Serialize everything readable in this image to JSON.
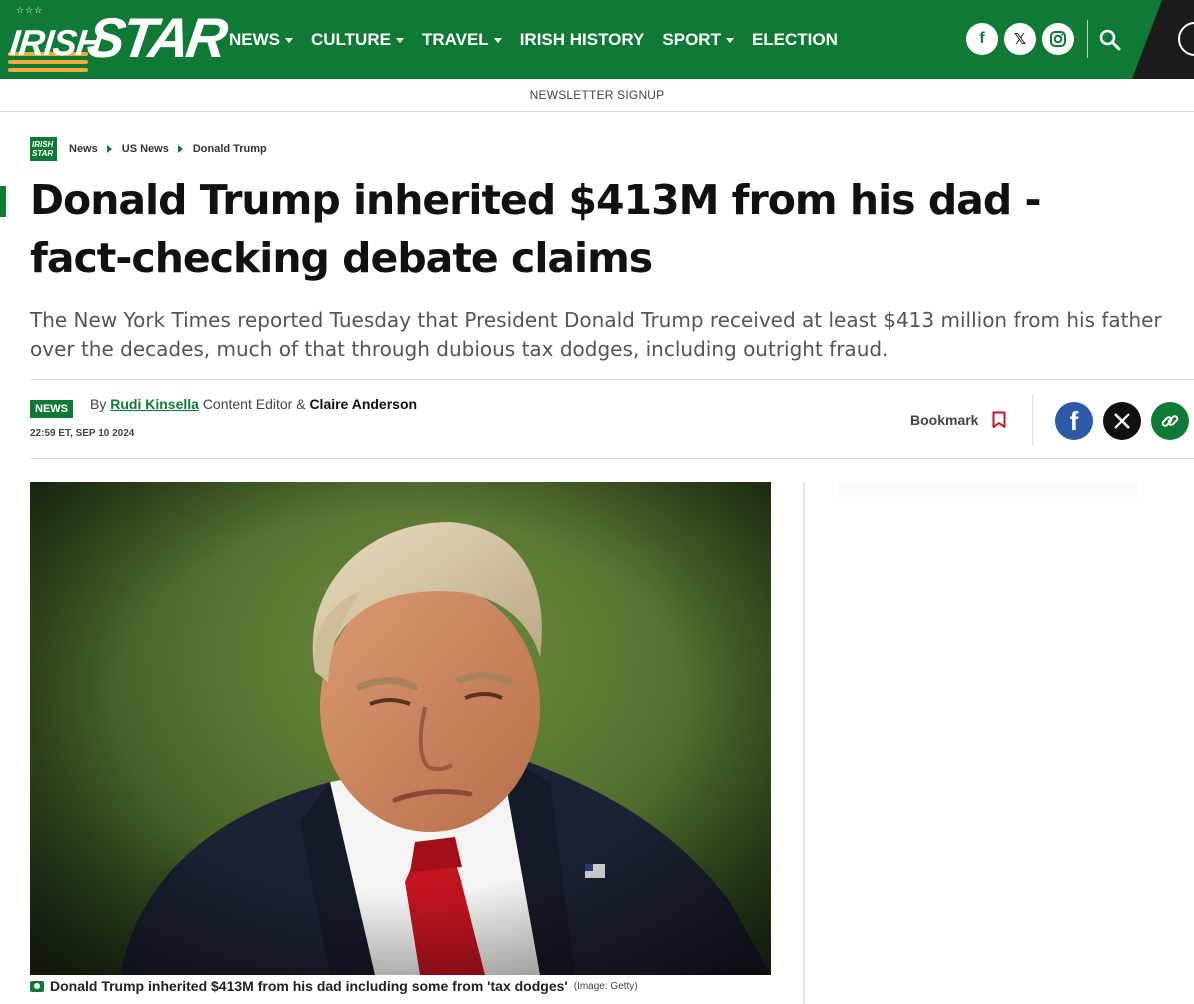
{
  "header": {
    "logo": {
      "stars": "☆☆☆",
      "irish": "IRISH",
      "star": "STAR"
    },
    "nav": [
      {
        "label": "NEWS",
        "dropdown": true
      },
      {
        "label": "CULTURE",
        "dropdown": true
      },
      {
        "label": "TRAVEL",
        "dropdown": true
      },
      {
        "label": "IRISH HISTORY",
        "dropdown": false
      },
      {
        "label": "SPORT",
        "dropdown": true
      },
      {
        "label": "ELECTION",
        "dropdown": false
      }
    ],
    "social": [
      {
        "icon": "facebook-icon",
        "glyph": "f"
      },
      {
        "icon": "x-icon",
        "glyph": "𝕏"
      },
      {
        "icon": "instagram-icon",
        "glyph": "◎"
      }
    ],
    "search_icon": "search-icon",
    "account_icon": "user-account-icon",
    "colors": {
      "brand_green": "#0f7a36",
      "accent_orange": "#f2a93b",
      "dark_panel": "#1c1c1c"
    }
  },
  "newsletter": {
    "label": "NEWSLETTER SIGNUP"
  },
  "breadcrumb": {
    "logo_text": "IRISH STAR",
    "items": [
      "News",
      "US News",
      "Donald Trump"
    ]
  },
  "article": {
    "headline": "Donald Trump inherited $413M from his dad - fact-checking debate claims",
    "standfirst": "The New York Times reported Tuesday that President Donald Trump received at least $413 million from his father over the decades, much of that through dubious tax dodges, including outright fraud.",
    "category": "NEWS",
    "byline": {
      "by": "By",
      "author1": "Rudi Kinsella",
      "role1": "Content Editor &",
      "author2": "Claire Anderson"
    },
    "dateline": "22:59 ET, SEP 10 2024",
    "bookmark_label": "Bookmark",
    "share": [
      {
        "icon": "facebook-share-icon",
        "glyph": "f",
        "color": "#2d5aa6"
      },
      {
        "icon": "x-share-icon",
        "glyph": "𝕏",
        "color": "#111111"
      },
      {
        "icon": "copy-link-icon",
        "glyph": "🔗",
        "color": "#0f7a36"
      }
    ],
    "image": {
      "caption": "Donald Trump inherited $413M from his dad including some from 'tax dodges'",
      "credit": "(Image: Getty)"
    }
  }
}
